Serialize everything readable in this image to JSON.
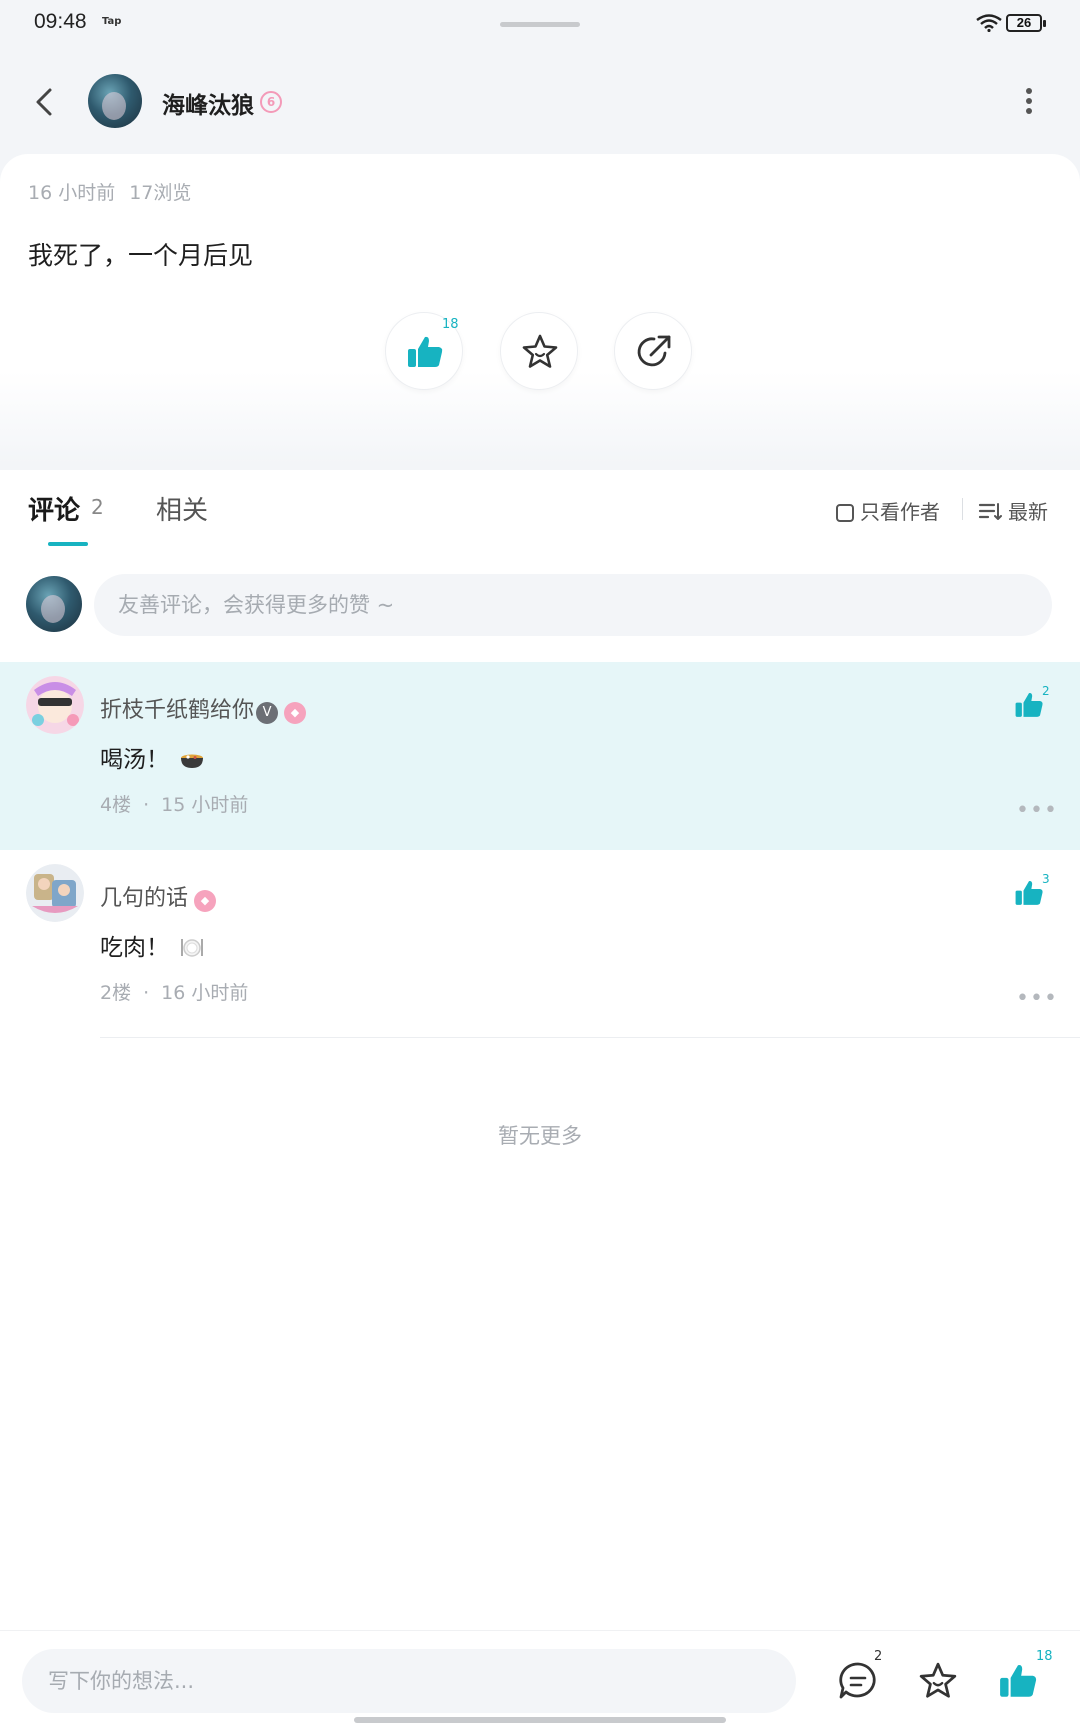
{
  "status_bar": {
    "time": "09:48",
    "app_label": "Tap",
    "battery": "26",
    "icons": [
      "wifi-icon",
      "battery-icon"
    ]
  },
  "header": {
    "author_name": "海峰汰狼",
    "level_badge": "6",
    "icons": [
      "back-arrow-icon",
      "more-vertical-icon"
    ]
  },
  "post": {
    "time_ago": "16 小时前",
    "views": "17浏览",
    "text": "我死了，一个月后见",
    "like_count": "18",
    "actions": [
      "thumbs-up-icon",
      "star-icon",
      "share-icon"
    ]
  },
  "tabs": {
    "comments_label": "评论",
    "comments_count": "2",
    "related_label": "相关",
    "only_author_label": "只看作者",
    "sort_label": "最新"
  },
  "comment_input": {
    "placeholder": "友善评论，会获得更多的赞 ~"
  },
  "comments": [
    {
      "user": "折枝千纸鹤给你",
      "verified": "V",
      "text": "喝汤！",
      "floor": "4楼",
      "time_ago": "15 小时前",
      "likes": "2",
      "highlighted": true,
      "emoji": "soup-pot-icon"
    },
    {
      "user": "几句的话",
      "text": "吃肉！",
      "floor": "2楼",
      "time_ago": "16 小时前",
      "likes": "3",
      "highlighted": false,
      "emoji": "plate-cutlery-icon"
    }
  ],
  "footer": {
    "no_more": "暂无更多"
  },
  "bottom_bar": {
    "placeholder": "写下你的想法...",
    "comment_count": "2",
    "like_count": "18"
  },
  "colors": {
    "accent": "#17b3c1",
    "page_bg": "#f3f5f8",
    "highlight_bg": "#e6f6f8",
    "muted_text": "#a8acb2",
    "pink_badge": "#f39ab8"
  }
}
